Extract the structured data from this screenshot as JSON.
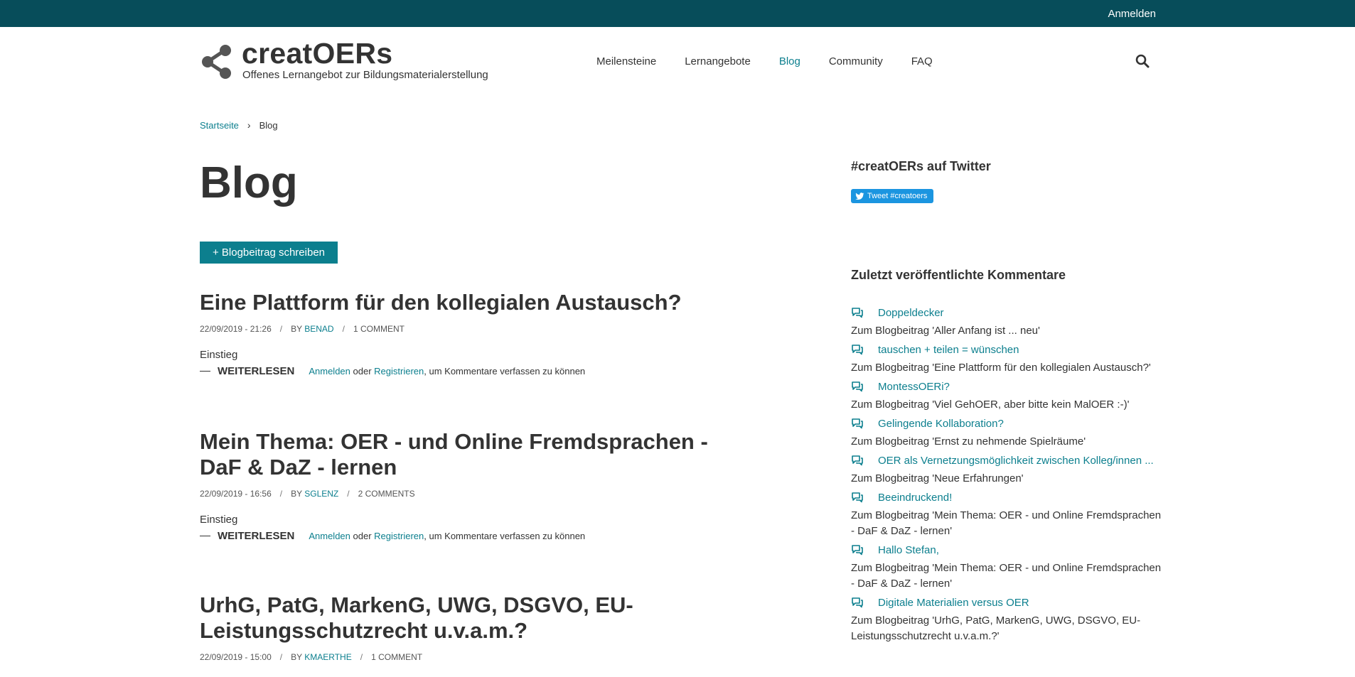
{
  "topbar": {
    "login_label": "Anmelden"
  },
  "header": {
    "site_name": "creatOERs",
    "slogan": "Offenes Lernangebot zur Bildungsmaterialerstellung",
    "nav": [
      "Meilensteine",
      "Lernangebote",
      "Blog",
      "Community",
      "FAQ"
    ],
    "active_nav": "Blog"
  },
  "breadcrumb": {
    "home": "Startseite",
    "separator": "›",
    "current": "Blog"
  },
  "page": {
    "title": "Blog",
    "add_button": "+ Blogbeitrag schreiben"
  },
  "posts": [
    {
      "title": "Eine Plattform für den kollegialen Austausch?",
      "date": "22/09/2019 - 21:26",
      "by": "BY",
      "author": "BENAD",
      "comments": "1 COMMENT",
      "body": "Einstieg",
      "readmore": "WEITERLESEN",
      "login": "Anmelden",
      "or": "oder",
      "register": "Registrieren",
      "suffix": ", um Kommentare verfassen zu können"
    },
    {
      "title": "Mein Thema: OER - und Online Fremdsprachen - DaF & DaZ - lernen",
      "date": "22/09/2019 - 16:56",
      "by": "BY",
      "author": "SGLENZ",
      "comments": "2 COMMENTS",
      "body": "Einstieg",
      "readmore": "WEITERLESEN",
      "login": "Anmelden",
      "or": "oder",
      "register": "Registrieren",
      "suffix": ", um Kommentare verfassen zu können"
    },
    {
      "title": "UrhG, PatG, MarkenG, UWG, DSGVO, EU-Leistungsschutzrecht u.v.a.m.?",
      "date": "22/09/2019 - 15:00",
      "by": "BY",
      "author": "KMAERTHE",
      "comments": "1 COMMENT"
    }
  ],
  "sidebar": {
    "twitter_heading": "#creatOERs auf Twitter",
    "tweet_button": "Tweet #creatoers",
    "comments_heading": "Zuletzt veröffentlichte Kommentare",
    "comments": [
      {
        "title": "Doppeldecker",
        "ref": "Zum Blogbeitrag 'Aller Anfang ist ... neu'"
      },
      {
        "title": "tauschen + teilen = wünschen",
        "ref": "Zum Blogbeitrag 'Eine Plattform für den kollegialen Austausch?'"
      },
      {
        "title": "MontessOERi?",
        "ref": "Zum Blogbeitrag 'Viel GehOER, aber bitte kein MalOER :-)'"
      },
      {
        "title": "Gelingende Kollaboration?",
        "ref": "Zum Blogbeitrag 'Ernst zu nehmende Spielräume'"
      },
      {
        "title": "OER als Vernetzungsmöglichkeit zwischen Kolleg/innen ...",
        "ref": "Zum Blogbeitrag 'Neue Erfahrungen'"
      },
      {
        "title": "Beeindruckend!",
        "ref": "Zum Blogbeitrag 'Mein Thema: OER - und Online Fremdsprachen - DaF & DaZ - lernen'"
      },
      {
        "title": "Hallo Stefan,",
        "ref": "Zum Blogbeitrag 'Mein Thema: OER - und Online Fremdsprachen - DaF & DaZ - lernen'"
      },
      {
        "title": "Digitale Materialien versus OER",
        "ref": "Zum Blogbeitrag 'UrhG, PatG, MarkenG, UWG, DSGVO, EU-Leistungsschutzrecht u.v.a.m.?'"
      }
    ]
  },
  "colors": {
    "topbar": "#074d5a",
    "accent": "#0c7f8e",
    "tweet": "#1b95e0",
    "text": "#333333"
  },
  "icons": [
    "share-logo-icon",
    "search-icon",
    "twitter-bird-icon",
    "comment-icon"
  ]
}
